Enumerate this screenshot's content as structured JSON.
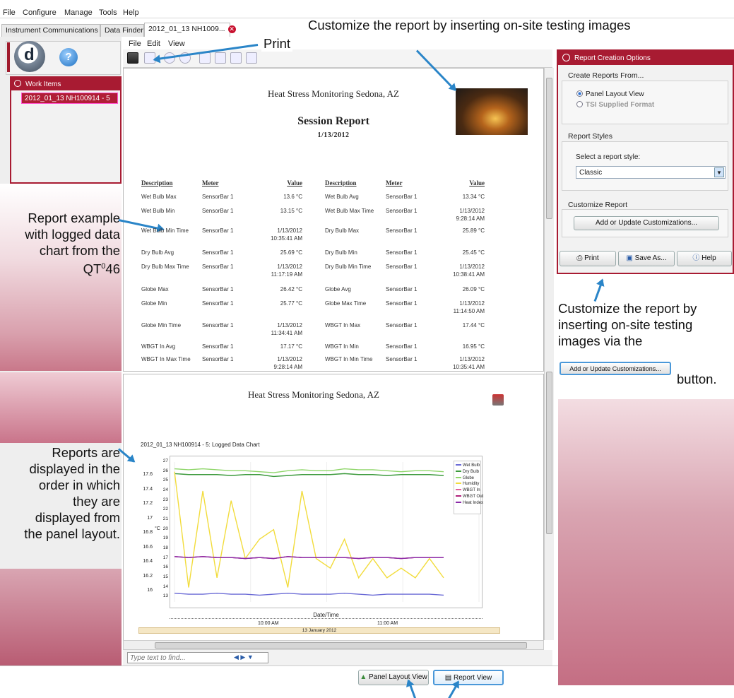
{
  "menu": {
    "file": "File",
    "configure": "Configure",
    "manage": "Manage",
    "tools": "Tools",
    "help": "Help"
  },
  "tabs": [
    {
      "label": "Instrument Communications"
    },
    {
      "label": "Data Finder"
    },
    {
      "label": "2012_01_13 NH1009..."
    }
  ],
  "left_panel": {
    "header": "Work Items",
    "item": "2012_01_13 NH100914 - 5"
  },
  "viewer_menu": {
    "file": "File",
    "edit": "Edit",
    "view": "View"
  },
  "report": {
    "title": "Heat Stress Monitoring Sedona, AZ",
    "session": "Session Report",
    "date": "1/13/2012",
    "headers": [
      "Description",
      "Meter",
      "Value",
      "Description",
      "Meter",
      "Value"
    ],
    "rows": [
      [
        "Wet Bulb Max",
        "SensorBar 1",
        "13.6 °C",
        "Wet Bulb Avg",
        "SensorBar 1",
        "13.34 °C"
      ],
      [
        "Wet Bulb Min",
        "SensorBar 1",
        "13.15 °C",
        "Wet Bulb Max Time",
        "SensorBar 1",
        "1/13/2012\n9:28:14 AM"
      ],
      [
        "Wet Bulb Min Time",
        "SensorBar 1",
        "1/13/2012\n10:35:41 AM",
        "Dry Bulb Max",
        "SensorBar 1",
        "25.89 °C"
      ],
      [
        "Dry Bulb Avg",
        "SensorBar 1",
        "25.69 °C",
        "Dry Bulb Min",
        "SensorBar 1",
        "25.45 °C"
      ],
      [
        "Dry Bulb Max Time",
        "SensorBar 1",
        "1/13/2012\n11:17:19 AM",
        "Dry Bulb Min Time",
        "SensorBar 1",
        "1/13/2012\n10:38:41 AM"
      ],
      [
        "Globe Max",
        "SensorBar 1",
        "26.42 °C",
        "Globe Avg",
        "SensorBar 1",
        "26.09 °C"
      ],
      [
        "Globe Min",
        "SensorBar 1",
        "25.77 °C",
        "Globe Max Time",
        "SensorBar 1",
        "1/13/2012\n11:14:50 AM"
      ],
      [
        "Globe Min Time",
        "SensorBar 1",
        "1/13/2012\n11:34:41 AM",
        "WBGT In Max",
        "SensorBar 1",
        "17.44 °C"
      ],
      [
        "WBGT In Avg",
        "SensorBar 1",
        "17.17 °C",
        "WBGT In Min",
        "SensorBar 1",
        "16.95 °C"
      ],
      [
        "WBGT In Max Time",
        "SensorBar 1",
        "1/13/2012\n9:28:14 AM",
        "WBGT In Min Time",
        "SensorBar 1",
        "1/13/2012\n10:35:41 AM"
      ]
    ]
  },
  "page2": {
    "title": "Heat Stress Monitoring Sedona, AZ",
    "chart_caption": "2012_01_13 NH100914 - 5: Logged Data Chart"
  },
  "chart_data": {
    "type": "line",
    "xlabel": "Date/Time",
    "ylabel": "°C",
    "x_ticks": [
      "10:00 AM",
      "11:00 AM"
    ],
    "x_band": "13 January 2012",
    "y_left_ticks": [
      "17.6",
      "17.4",
      "17.2",
      "17",
      "16.8",
      "16.6",
      "16.4",
      "16.2",
      "16"
    ],
    "y_ticks": [
      "27",
      "26",
      "25",
      "24",
      "23",
      "22",
      "21",
      "20",
      "19",
      "18",
      "17",
      "16",
      "15",
      "14",
      "13"
    ],
    "ylim": [
      12.5,
      27
    ],
    "legend_position": "top-right",
    "series": [
      {
        "name": "Wet Bulb",
        "color": "#6b6bd6",
        "values": [
          13.4,
          13.3,
          13.3,
          13.4,
          13.3,
          13.3,
          13.2,
          13.3,
          13.4,
          13.3,
          13.3,
          13.3,
          13.4,
          13.3,
          13.2,
          13.3,
          13.3,
          13.3,
          13.3,
          13.2
        ]
      },
      {
        "name": "Dry Bulb",
        "color": "#3c9a3c",
        "values": [
          25.8,
          25.7,
          25.7,
          25.7,
          25.6,
          25.7,
          25.7,
          25.5,
          25.6,
          25.7,
          25.7,
          25.7,
          25.8,
          25.7,
          25.7,
          25.6,
          25.7,
          25.7,
          25.7,
          25.6
        ]
      },
      {
        "name": "Globe",
        "color": "#8fd66a",
        "values": [
          26.3,
          26.2,
          26.3,
          26.2,
          26.1,
          26.1,
          26.0,
          25.9,
          26.1,
          26.2,
          26.1,
          26.1,
          26.3,
          26.2,
          26.2,
          26.1,
          26.0,
          26.1,
          26.1,
          26.0
        ]
      },
      {
        "name": "Humidity",
        "color": "#f2dc3c",
        "values": [
          26,
          14,
          24,
          15,
          23,
          17,
          19,
          20,
          14,
          24,
          17,
          16,
          19,
          15,
          17,
          15,
          16,
          15,
          17,
          15
        ]
      },
      {
        "name": "WBGT In",
        "color": "#e0609a",
        "values": [
          17.2,
          17.1,
          17.2,
          17.1,
          17.1,
          17.0,
          17.1,
          17.0,
          17.2,
          17.1,
          17.1,
          17.1,
          17.1,
          17.0,
          17.1,
          17.1,
          17.0,
          17.1,
          17.1,
          17.1
        ]
      },
      {
        "name": "WBGT Out",
        "color": "#b0207a",
        "values": [
          17.2,
          17.1,
          17.2,
          17.1,
          17.1,
          17.0,
          17.1,
          17.0,
          17.2,
          17.1,
          17.1,
          17.1,
          17.1,
          17.0,
          17.1,
          17.1,
          17.0,
          17.1,
          17.1,
          17.1
        ]
      },
      {
        "name": "Heat Index",
        "color": "#8a2aa8",
        "values": [
          17.2,
          17.1,
          17.2,
          17.1,
          17.1,
          17.0,
          17.1,
          17.0,
          17.2,
          17.1,
          17.1,
          17.1,
          17.1,
          17.0,
          17.1,
          17.1,
          17.0,
          17.1,
          17.1,
          17.1
        ]
      }
    ]
  },
  "find": {
    "placeholder": "Type text to find..."
  },
  "bottom_buttons": {
    "panel": "Panel Layout View",
    "report": "Report View"
  },
  "right_panel": {
    "header": "Report Creation Options",
    "create_from": "Create Reports From...",
    "opt_panel": "Panel Layout View",
    "opt_tsi": "TSI Supplied Format",
    "styles": "Report Styles",
    "select_label": "Select a report style:",
    "selected_style": "Classic",
    "customize": "Customize Report",
    "customize_btn": "Add or Update Customizations...",
    "print": "Print",
    "save": "Save As...",
    "help": "Help"
  },
  "annotations": {
    "print": "Print",
    "customize_top": "Customize the report by inserting on-site testing images",
    "report_example_1": "Report example",
    "report_example_2": "with logged data",
    "report_example_3": "chart from the",
    "report_example_4": "QT",
    "report_example_sup": "0",
    "report_example_5": "46",
    "order_1": "Reports are",
    "order_2": "displayed in the",
    "order_3": "order in which",
    "order_4": "they are",
    "order_5": "displayed from",
    "order_6": "the panel layout.",
    "customize_right_1": "Customize the report by",
    "customize_right_2": "inserting on-site testing",
    "customize_right_3": "images via the",
    "customize_right_btn": "Add or Update Customizations...",
    "customize_right_4": "button."
  }
}
